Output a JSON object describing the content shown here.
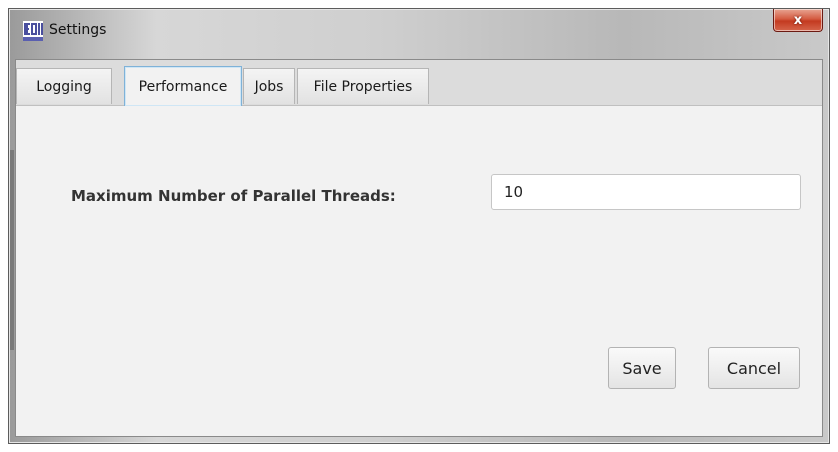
{
  "window": {
    "title": "Settings",
    "logo_icon": "eon-logo-icon",
    "close_label": "x"
  },
  "tabs": [
    {
      "label": "Logging",
      "active": false
    },
    {
      "label": "Performance",
      "active": true
    },
    {
      "label": "Jobs",
      "active": false
    },
    {
      "label": "File Properties",
      "active": false
    }
  ],
  "performance": {
    "max_threads_label": "Maximum Number of Parallel Threads:",
    "max_threads_value": "10"
  },
  "buttons": {
    "save_label": "Save",
    "cancel_label": "Cancel"
  },
  "colors": {
    "close_button": "#c33a20",
    "active_tab_border": "#7fb2d8",
    "panel_background": "#f2f2f2"
  }
}
